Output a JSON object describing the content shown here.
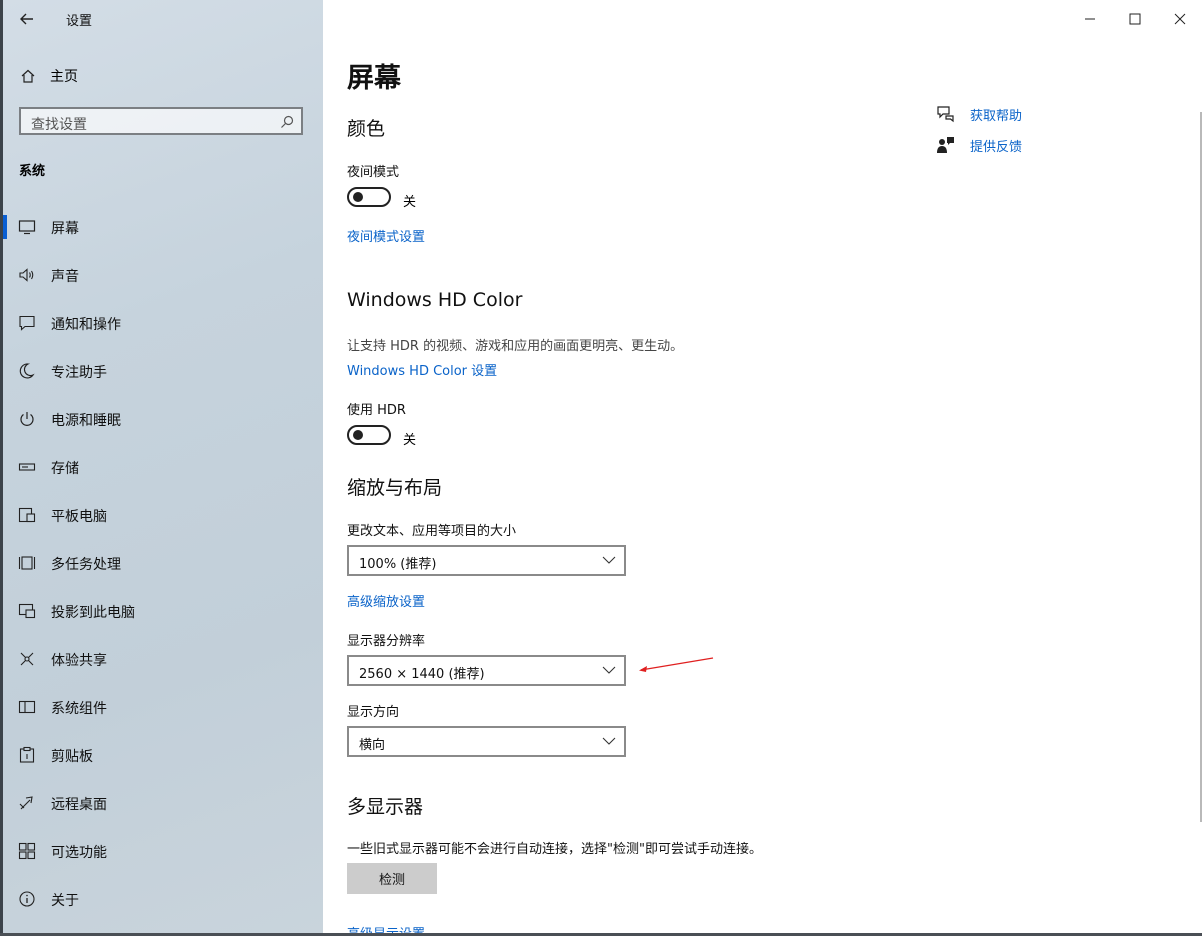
{
  "app": {
    "title": "设置"
  },
  "sidebar": {
    "home_label": "主页",
    "search": {
      "placeholder": "查找设置"
    },
    "section_title": "系统",
    "items": [
      {
        "label": "屏幕",
        "icon": "monitor-icon",
        "active": true
      },
      {
        "label": "声音",
        "icon": "speaker-icon"
      },
      {
        "label": "通知和操作",
        "icon": "notification-icon"
      },
      {
        "label": "专注助手",
        "icon": "moon-icon"
      },
      {
        "label": "电源和睡眠",
        "icon": "power-icon"
      },
      {
        "label": "存储",
        "icon": "storage-icon"
      },
      {
        "label": "平板电脑",
        "icon": "tablet-icon"
      },
      {
        "label": "多任务处理",
        "icon": "multitask-icon"
      },
      {
        "label": "投影到此电脑",
        "icon": "project-icon"
      },
      {
        "label": "体验共享",
        "icon": "share-icon"
      },
      {
        "label": "系统组件",
        "icon": "components-icon"
      },
      {
        "label": "剪贴板",
        "icon": "clipboard-icon"
      },
      {
        "label": "远程桌面",
        "icon": "remote-desktop-icon"
      },
      {
        "label": "可选功能",
        "icon": "optional-features-icon"
      },
      {
        "label": "关于",
        "icon": "info-icon"
      }
    ]
  },
  "main": {
    "page_title": "屏幕",
    "color": {
      "heading": "颜色",
      "night_mode_label": "夜间模式",
      "night_mode_state": "关",
      "night_mode_link": "夜间模式设置"
    },
    "hdr": {
      "heading": "Windows HD Color",
      "description": "让支持 HDR 的视频、游戏和应用的画面更明亮、更生动。",
      "settings_link": "Windows HD Color 设置",
      "use_hdr_label": "使用 HDR",
      "use_hdr_state": "关"
    },
    "scale": {
      "heading": "缩放与布局",
      "size_label": "更改文本、应用等项目的大小",
      "size_value": "100% (推荐)",
      "advanced_link": "高级缩放设置",
      "resolution_label": "显示器分辨率",
      "resolution_value": "2560 × 1440 (推荐)",
      "orientation_label": "显示方向",
      "orientation_value": "横向"
    },
    "multi": {
      "heading": "多显示器",
      "description": "一些旧式显示器可能不会进行自动连接，选择\"检测\"即可尝试手动连接。",
      "detect_button": "检测",
      "advanced_link": "高级显示设置"
    },
    "help": {
      "get_help": "获取帮助",
      "feedback": "提供反馈"
    }
  },
  "colors": {
    "accent": "#0a5fd3",
    "link": "#0a63c9",
    "annotation": "#e02020"
  }
}
